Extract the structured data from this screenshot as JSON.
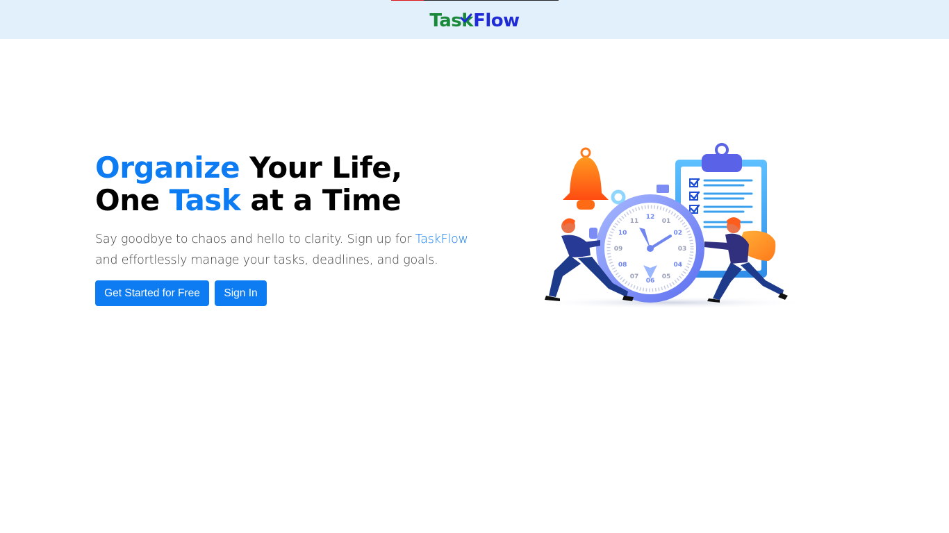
{
  "header": {
    "logo_task": "Task",
    "logo_flow": "Flow"
  },
  "hero": {
    "title_line1_accent": "Organize",
    "title_line1_rest": " Your Life,",
    "title_line2_start": "One ",
    "title_line2_accent": "Task",
    "title_line2_end": " at a Time",
    "description_before": "Say goodbye to chaos and hello to clarity. Sign up for ",
    "description_brand": "TaskFlow",
    "description_after": " and effortlessly manage your tasks, deadlines, and goals.",
    "cta_primary": "Get Started for Free",
    "cta_secondary": "Sign In"
  },
  "clock_numbers": [
    "12",
    "01",
    "02",
    "03",
    "04",
    "05",
    "06",
    "07",
    "08",
    "09",
    "10",
    "11"
  ],
  "colors": {
    "accent": "#0d7cf2",
    "header_bg": "#e1f0fb",
    "logo_green": "#1a8a3a",
    "logo_blue": "#1f2bd6"
  },
  "illustration": {
    "icons": [
      "bell-icon",
      "stopwatch-icon",
      "clipboard-checklist-icon",
      "person-pushing-icon"
    ]
  }
}
